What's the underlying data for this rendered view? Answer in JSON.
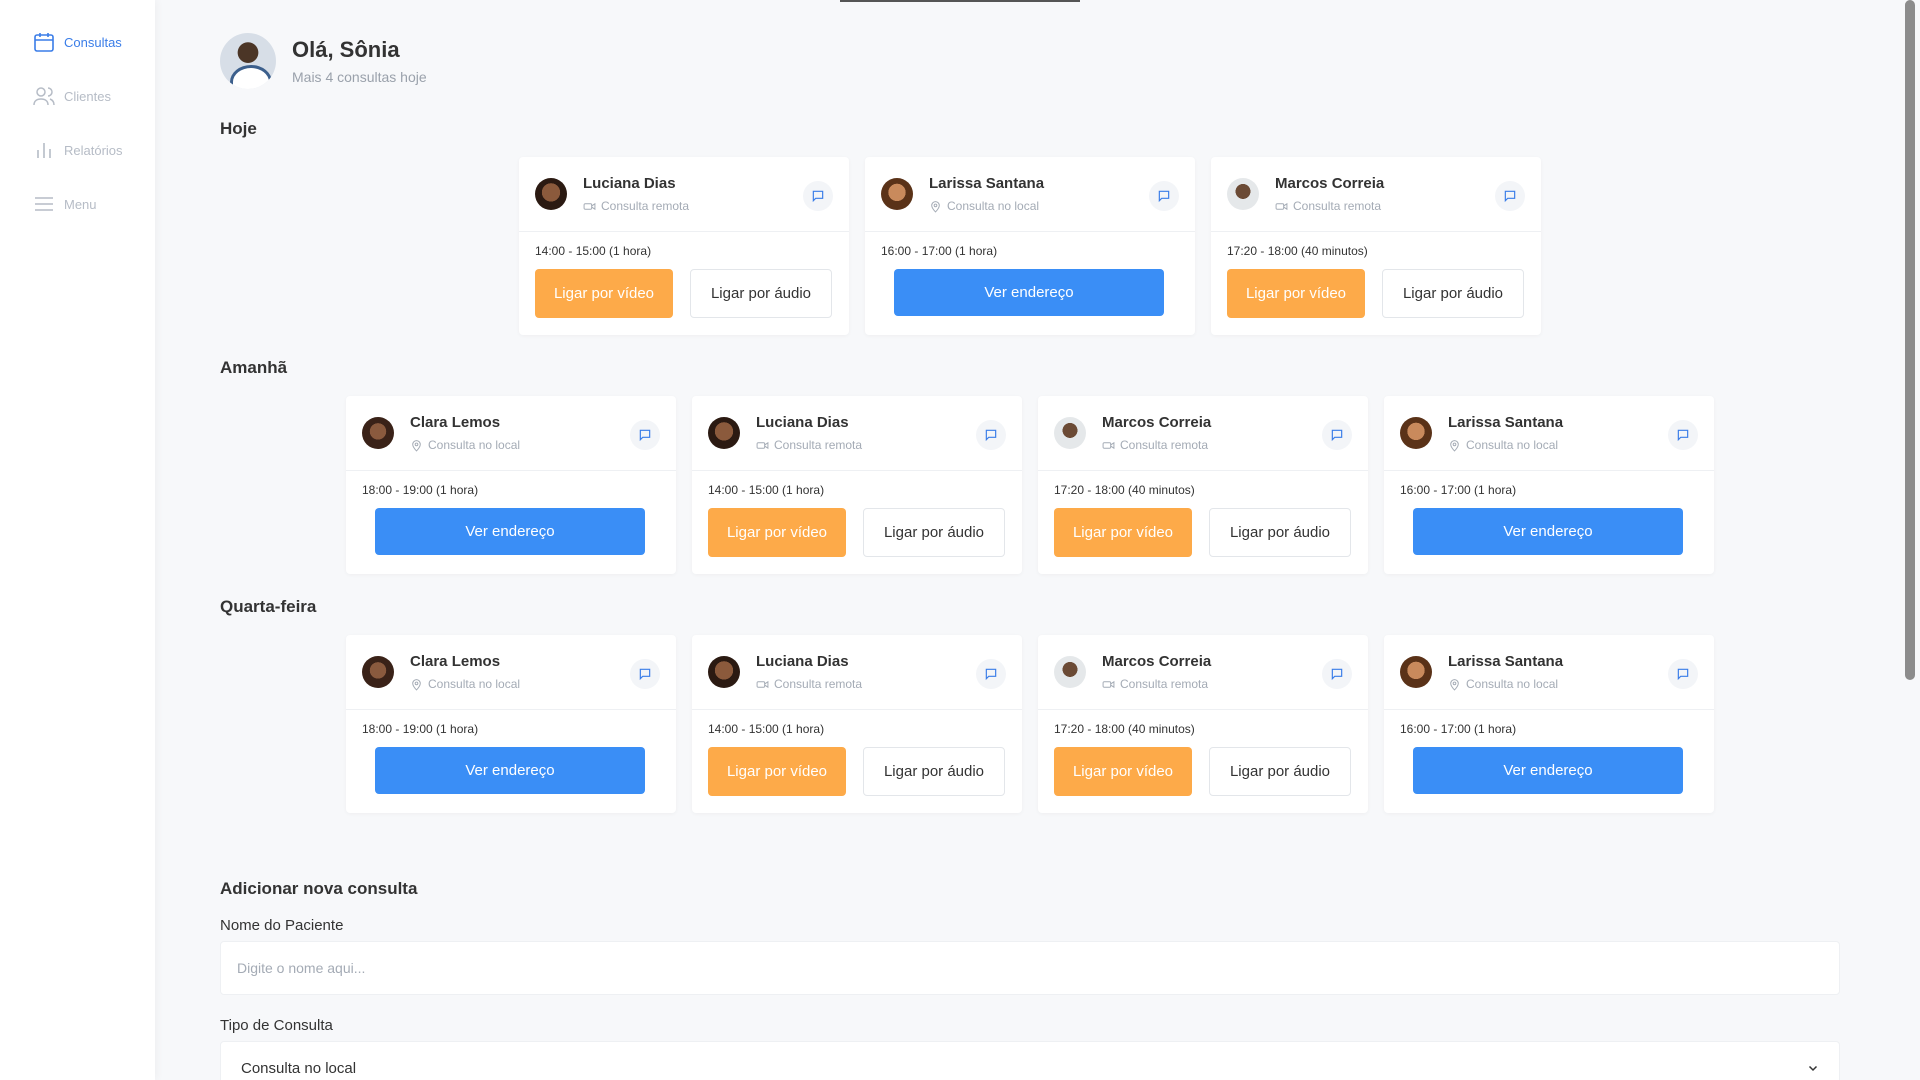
{
  "sidebar": {
    "items": [
      {
        "label": "Consultas",
        "icon": "calendar-icon",
        "active": true
      },
      {
        "label": "Clientes",
        "icon": "users-icon"
      },
      {
        "label": "Relatórios",
        "icon": "bar-chart-icon"
      },
      {
        "label": "Menu",
        "icon": "menu-icon"
      }
    ]
  },
  "header": {
    "greeting": "Olá, Sônia",
    "subtitle": "Mais 4 consultas hoje"
  },
  "sections": {
    "hoje": {
      "title": "Hoje",
      "cards": [
        {
          "name": "Luciana Dias",
          "type": "Consulta remota",
          "time": "14:00 - 15:00 (1 hora)",
          "video": "Ligar por vídeo",
          "audio": "Ligar por áudio"
        },
        {
          "name": "Larissa Santana",
          "type": "Consulta no local",
          "time": "16:00 - 17:00 (1 hora)",
          "address": "Ver endereço"
        },
        {
          "name": "Marcos Correia",
          "type": "Consulta remota",
          "time": "17:20 - 18:00 (40 minutos)",
          "video": "Ligar por vídeo",
          "audio": "Ligar por áudio"
        }
      ]
    },
    "amanha": {
      "title": "Amanhã",
      "cards": [
        {
          "name": "Clara Lemos",
          "type": "Consulta no local",
          "time": "18:00 - 19:00 (1 hora)",
          "address": "Ver endereço"
        },
        {
          "name": "Luciana Dias",
          "type": "Consulta remota",
          "time": "14:00 - 15:00 (1 hora)",
          "video": "Ligar por vídeo",
          "audio": "Ligar por áudio"
        },
        {
          "name": "Marcos Correia",
          "type": "Consulta remota",
          "time": "17:20 - 18:00 (40 minutos)",
          "video": "Ligar por vídeo",
          "audio": "Ligar por áudio"
        },
        {
          "name": "Larissa Santana",
          "type": "Consulta no local",
          "time": "16:00 - 17:00 (1 hora)",
          "address": "Ver endereço"
        }
      ]
    },
    "quarta": {
      "title": "Quarta-feira",
      "cards": [
        {
          "name": "Clara Lemos",
          "type": "Consulta no local",
          "time": "18:00 - 19:00 (1 hora)",
          "address": "Ver endereço"
        },
        {
          "name": "Luciana Dias",
          "type": "Consulta remota",
          "time": "14:00 - 15:00 (1 hora)",
          "video": "Ligar por vídeo",
          "audio": "Ligar por áudio"
        },
        {
          "name": "Marcos Correia",
          "type": "Consulta remota",
          "time": "17:20 - 18:00 (40 minutos)",
          "video": "Ligar por vídeo",
          "audio": "Ligar por áudio"
        },
        {
          "name": "Larissa Santana",
          "type": "Consulta no local",
          "time": "16:00 - 17:00 (1 hora)",
          "address": "Ver endereço"
        }
      ]
    }
  },
  "form": {
    "title": "Adicionar nova consulta",
    "patient_label": "Nome do Paciente",
    "patient_placeholder": "Digite o nome aqui...",
    "type_label": "Tipo de Consulta",
    "type_value": "Consulta no local"
  },
  "colors": {
    "accent": "#3a8ef6",
    "video": "#fdaa49",
    "active_nav": "#3a7de8"
  }
}
